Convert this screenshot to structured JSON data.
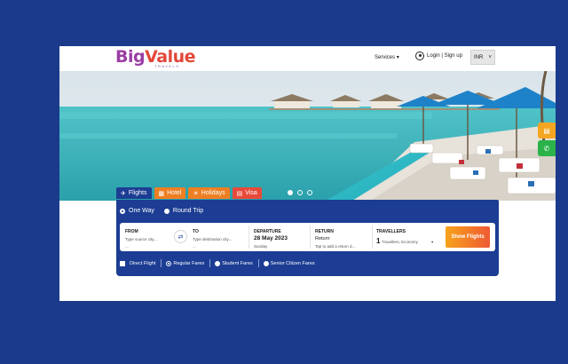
{
  "brand": {
    "logo_big": "Big",
    "logo_value": "Value",
    "logo_sub": "TRAVELS"
  },
  "nav": {
    "services_label": "Services",
    "services_caret": "▾",
    "login_label": "Login | Sign up",
    "currency_value": "INR",
    "currency_caret": "˅"
  },
  "side_buttons": [
    {
      "icon": "document-icon",
      "color": "#f4a621"
    },
    {
      "icon": "whatsapp-icon",
      "color": "#2bb34a"
    }
  ],
  "tabs": [
    {
      "label": "Flights",
      "icon": "plane-icon",
      "color": "#1c3d93"
    },
    {
      "label": "Hotel",
      "icon": "hotel-icon",
      "color": "#ee7f23"
    },
    {
      "label": "Holidays",
      "icon": "sun-icon",
      "color": "#ee7f23"
    },
    {
      "label": "Visa",
      "icon": "visa-icon",
      "color": "#e84a3a"
    }
  ],
  "trip_type": {
    "options": [
      "One Way",
      "Round Trip"
    ],
    "selected": "One Way"
  },
  "search": {
    "from": {
      "label": "FROM",
      "placeholder": "Type source city...",
      "dash": "—"
    },
    "to": {
      "label": "TO",
      "placeholder": "Type destination city...",
      "dash": "—"
    },
    "departure": {
      "label": "DEPARTURE",
      "date": "28 May 2023",
      "day": "Sunday"
    },
    "return": {
      "label": "RETURN",
      "value": "Return",
      "hint": "Tap to add a return d..."
    },
    "travellers": {
      "label": "TRAVELLERS",
      "count": "1",
      "detail": "Travellers, Economy",
      "caret": "▾"
    },
    "button": "Show Flights"
  },
  "fares": {
    "direct_flight": "Direct Flight",
    "options": [
      "Regular Fares",
      "Student Fares",
      "Senior Citizen Fares"
    ],
    "selected": "Regular Fares"
  },
  "carousel": {
    "slides": 3,
    "active": 1
  },
  "colors": {
    "page_bg": "#1b3a8c",
    "panel": "#1c3d93",
    "accent_orange": "#ee7f23",
    "accent_red": "#e84a3a"
  }
}
